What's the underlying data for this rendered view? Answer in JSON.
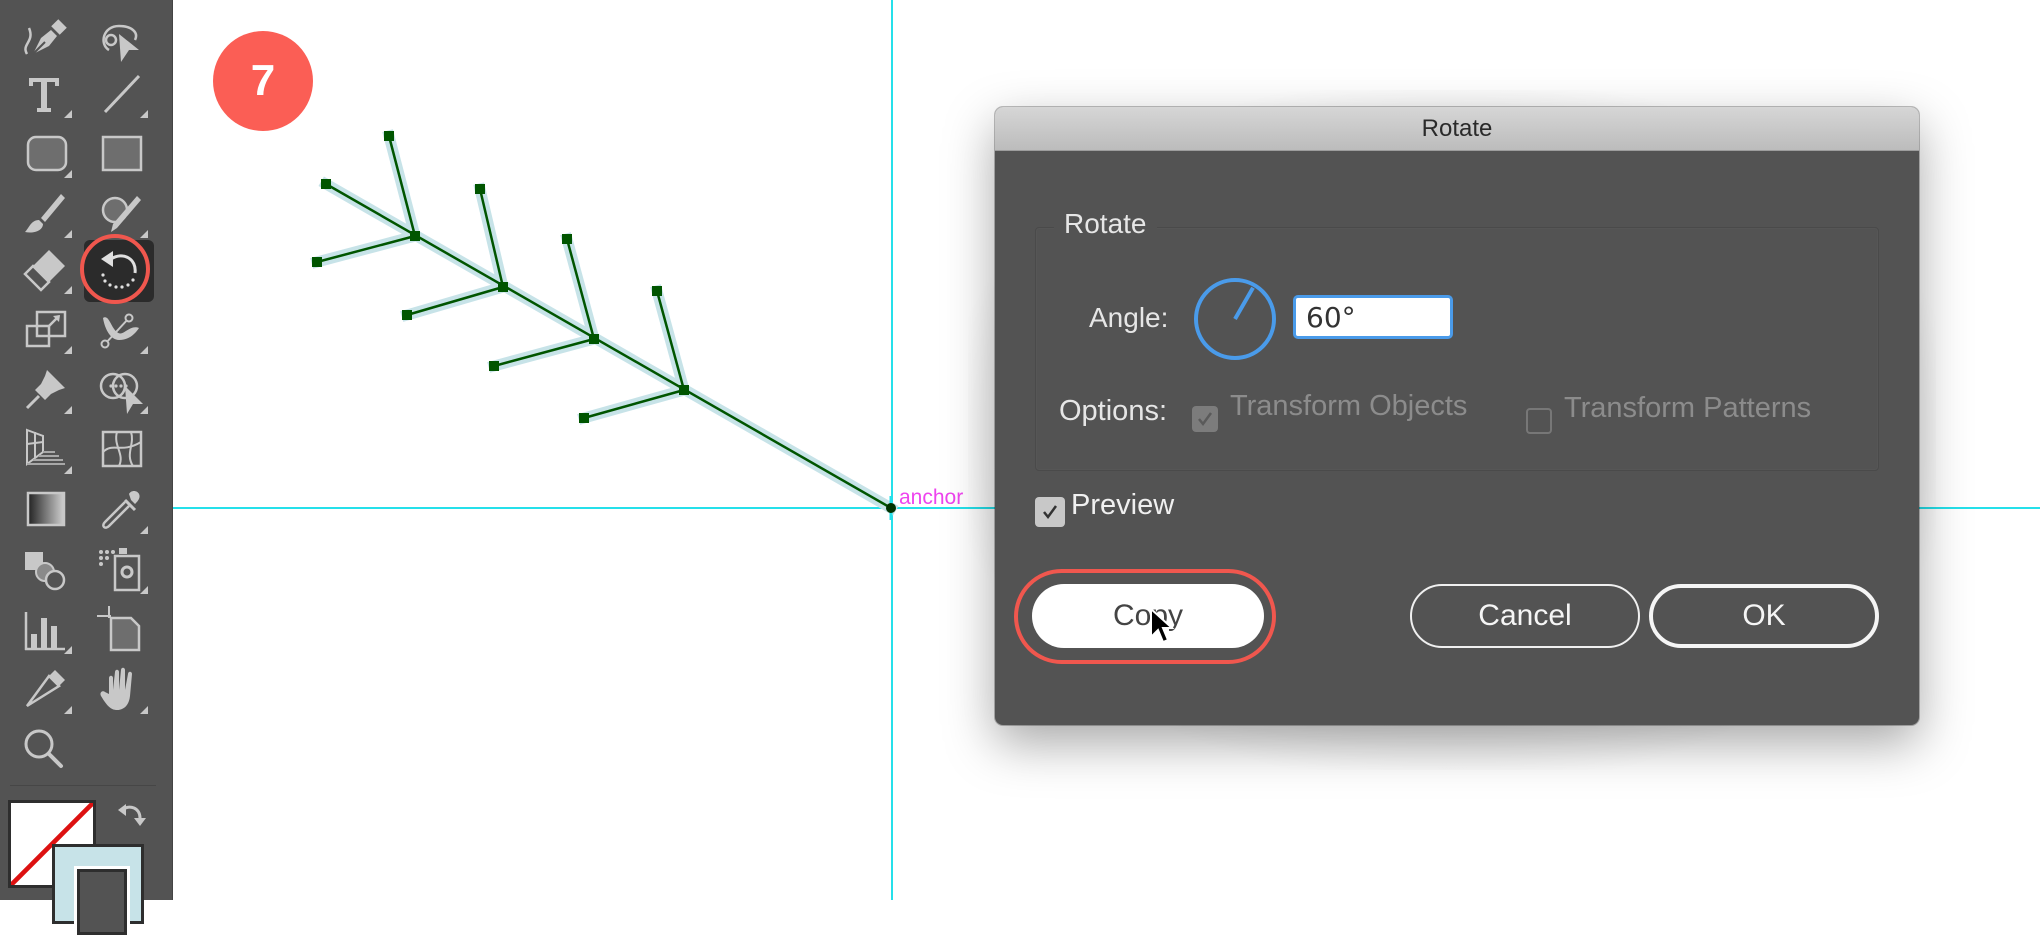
{
  "toolbar": {
    "tools": [
      {
        "name": "curvature-pen-tool",
        "icon": "pen-icon",
        "has_flyout": false
      },
      {
        "name": "lasso-select-tool",
        "icon": "lasso-select-icon",
        "has_flyout": false
      },
      {
        "name": "type-tool",
        "icon": "type-icon",
        "has_flyout": true
      },
      {
        "name": "line-segment-tool",
        "icon": "line-icon",
        "has_flyout": true
      },
      {
        "name": "rounded-rectangle-tool",
        "icon": "rounded-rectangle-icon",
        "has_flyout": true
      },
      {
        "name": "rectangle-tool",
        "icon": "rectangle-icon",
        "has_flyout": false
      },
      {
        "name": "paintbrush-tool",
        "icon": "paintbrush-icon",
        "has_flyout": true
      },
      {
        "name": "shaper-tool",
        "icon": "shaper-icon",
        "has_flyout": true
      },
      {
        "name": "eraser-tool",
        "icon": "eraser-icon",
        "has_flyout": true
      },
      {
        "name": "rotate-tool",
        "icon": "rotate-icon",
        "has_flyout": true,
        "active": true
      },
      {
        "name": "scale-tool",
        "icon": "scale-icon",
        "has_flyout": true
      },
      {
        "name": "puppet-warp-tool",
        "icon": "puppet-warp-icon",
        "has_flyout": true
      },
      {
        "name": "pin-tool",
        "icon": "pin-icon",
        "has_flyout": true
      },
      {
        "name": "shape-builder-tool",
        "icon": "shape-builder-icon",
        "has_flyout": true
      },
      {
        "name": "perspective-grid-tool",
        "icon": "perspective-grid-icon",
        "has_flyout": true
      },
      {
        "name": "mesh-tool",
        "icon": "mesh-icon",
        "has_flyout": false
      },
      {
        "name": "gradient-tool",
        "icon": "gradient-icon",
        "has_flyout": false
      },
      {
        "name": "eyedropper-tool",
        "icon": "eyedropper-icon",
        "has_flyout": true
      },
      {
        "name": "blend-tool",
        "icon": "blend-icon",
        "has_flyout": false
      },
      {
        "name": "symbol-sprayer-tool",
        "icon": "symbol-sprayer-icon",
        "has_flyout": true
      },
      {
        "name": "graph-tool",
        "icon": "bar-graph-icon",
        "has_flyout": true
      },
      {
        "name": "artboard-tool",
        "icon": "artboard-icon",
        "has_flyout": false
      },
      {
        "name": "pencil-tool",
        "icon": "pencil-icon",
        "has_flyout": true
      },
      {
        "name": "hand-tool",
        "icon": "hand-icon",
        "has_flyout": true
      },
      {
        "name": "zoom-tool",
        "icon": "zoom-icon",
        "has_flyout": false
      }
    ],
    "fill": "none",
    "stroke_color": "#c7e3e8"
  },
  "canvas": {
    "step_number": "7",
    "anchor_label": "anchor",
    "guide_color": "#25e0ea",
    "path_color": "#005500",
    "highlight_color": "#c7e3e8"
  },
  "dialog": {
    "title": "Rotate",
    "group_label": "Rotate",
    "angle_label": "Angle:",
    "angle_value": "60°",
    "angle_degrees": 60,
    "options_label": "Options:",
    "transform_objects": {
      "label": "Transform Objects",
      "checked": true,
      "enabled": false
    },
    "transform_patterns": {
      "label": "Transform Patterns",
      "checked": false,
      "enabled": false
    },
    "preview": {
      "label": "Preview",
      "checked": true
    },
    "buttons": {
      "copy": "Copy",
      "cancel": "Cancel",
      "ok": "OK"
    },
    "accent_color": "#4a9bea",
    "highlight_ring_color": "#f0574e"
  }
}
